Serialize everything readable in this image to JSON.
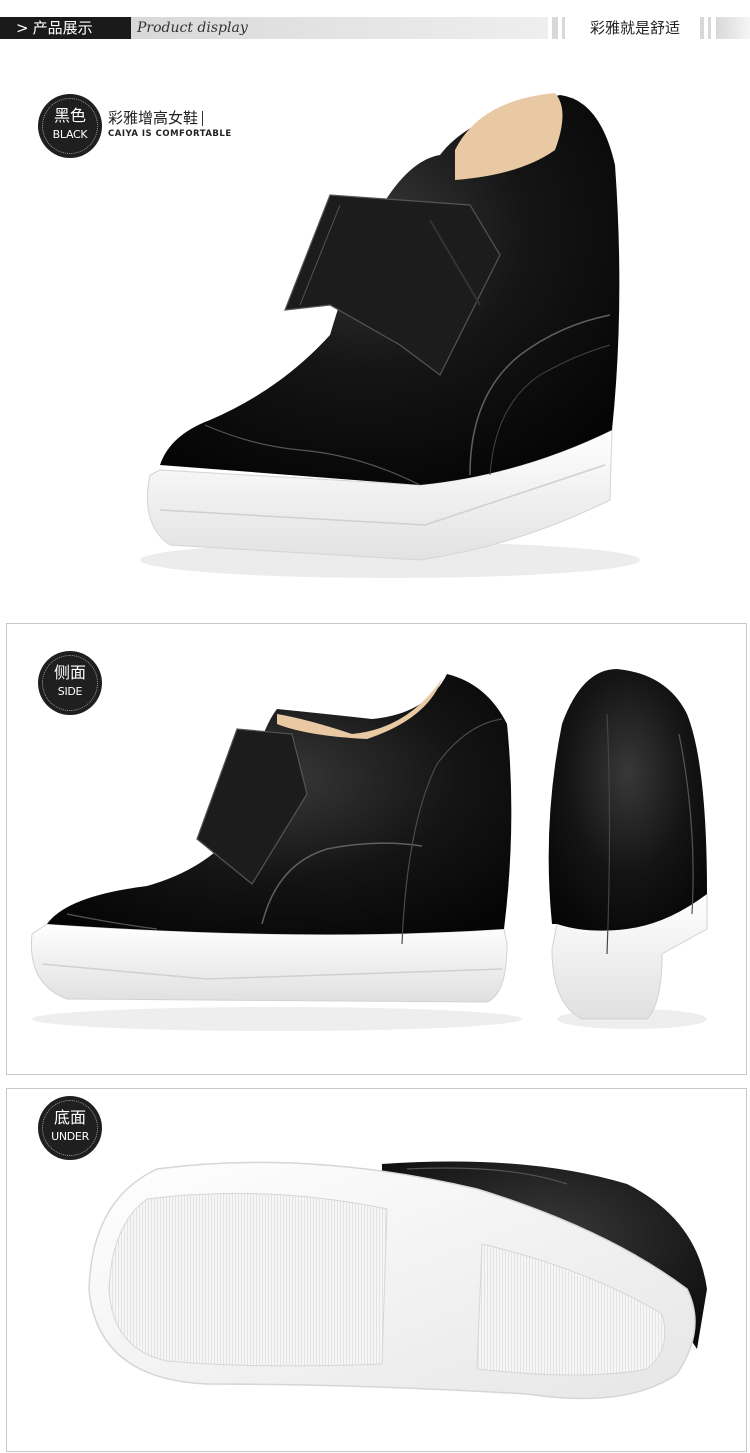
{
  "header": {
    "section_label": "产品展示",
    "arrow": ">",
    "subtitle": "Product display",
    "slogan": "彩雅就是舒适"
  },
  "sections": {
    "black": {
      "badge_cn": "黑色",
      "badge_en": "BLACK",
      "brand_cn": "彩雅增高女鞋",
      "brand_en": "CAIYA IS COMFORTABLE"
    },
    "side": {
      "badge_cn": "侧面",
      "badge_en": "SIDE"
    },
    "under": {
      "badge_cn": "底面",
      "badge_en": "UNDER"
    }
  },
  "colors": {
    "leather": "#141414",
    "sole": "#f7f7f7",
    "lining": "#e8c9a4",
    "badge": "#1f1f1f",
    "header_black": "#1a1a1a"
  }
}
